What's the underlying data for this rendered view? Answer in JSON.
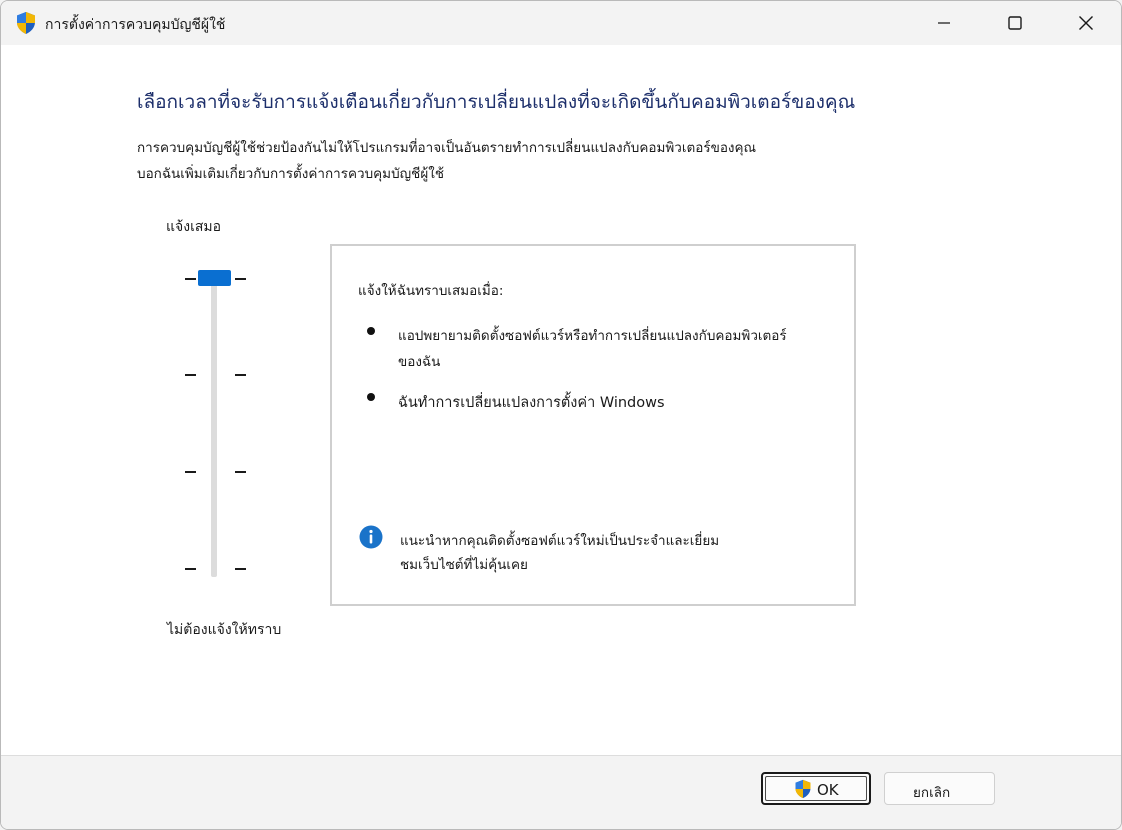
{
  "window": {
    "title": "การตั้งค่าการควบคุมบัญชีผู้ใช้",
    "icon": "uac-shield-icon"
  },
  "main": {
    "heading": "เลือกเวลาที่จะรับการแจ้งเตือนเกี่ยวกับการเปลี่ยนแปลงที่จะเกิดขึ้นกับคอมพิวเตอร์ของคุณ",
    "description": "การควบคุมบัญชีผู้ใช้ช่วยป้องกันไม่ให้โปรแกรมที่อาจเป็นอันตรายทำการเปลี่ยนแปลงกับคอมพิวเตอร์ของคุณ",
    "learn_more": "บอกฉันเพิ่มเติมเกี่ยวกับการตั้งค่าการควบคุมบัญชีผู้ใช้"
  },
  "slider": {
    "top_label": "แจ้งเสมอ",
    "bottom_label": "ไม่ต้องแจ้งให้ทราบ",
    "levels": 4,
    "selected_level": 1
  },
  "info_box": {
    "title": "แจ้งให้ฉันทราบเสมอเมื่อ:",
    "bullets": [
      "แอปพยายามติดตั้งซอฟต์แวร์หรือทำการเปลี่ยนแปลงกับคอมพิวเตอร์ของฉัน",
      "ฉันทำการเปลี่ยนแปลงการตั้งค่า Windows"
    ],
    "tip": "แนะนำหากคุณติดตั้งซอฟต์แวร์ใหม่เป็นประจำและเยี่ยมชมเว็บไซต์ที่ไม่คุ้นเคย"
  },
  "buttons": {
    "ok": "OK",
    "cancel": "ยกเลิก"
  },
  "colors": {
    "accent": "#0a6fd1",
    "heading": "#1d2f6b",
    "info_blue": "#1a73c9"
  }
}
